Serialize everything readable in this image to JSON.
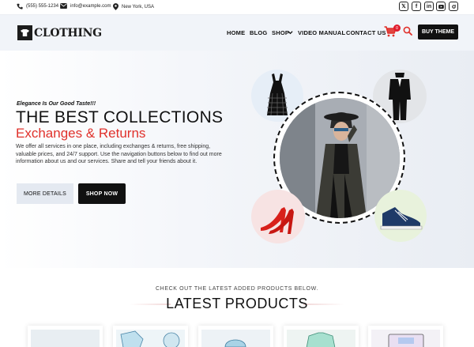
{
  "topbar": {
    "phone": "(555) 555-1234",
    "email": "info@example.com",
    "location": "New York, USA",
    "social_icons": [
      "x-icon",
      "facebook-icon",
      "linkedin-icon",
      "youtube-icon",
      "instagram-icon"
    ]
  },
  "header": {
    "logo_text": "CLOTHING",
    "nav": [
      "HOME",
      "BLOG",
      "SHOP",
      "VIDEO MANUAL",
      "CONTACT US"
    ],
    "cart_count": "0",
    "buy_label": "BUY THEME"
  },
  "hero": {
    "tagline": "Elegance Is Our Good Taste!!!",
    "title": "THE BEST COLLECTIONS",
    "subtitle": "Exchanges & Returns",
    "description": "We offer all services in one place, including exchanges & returns, free shipping, valuable prices, and 24/7 support. Use the navigation buttons below to find out more information about us and our services. Share and tell your friends about it.",
    "btn_details": "MORE DETAILS",
    "btn_shop": "SHOP NOW"
  },
  "latest": {
    "subtitle": "CHECK OUT THE LATEST ADDED PRODUCTS BELOW.",
    "title": "LATEST PRODUCTS"
  },
  "colors": {
    "accent": "#e0312b",
    "dark": "#111111",
    "header_bg": "#f1f4f9"
  }
}
